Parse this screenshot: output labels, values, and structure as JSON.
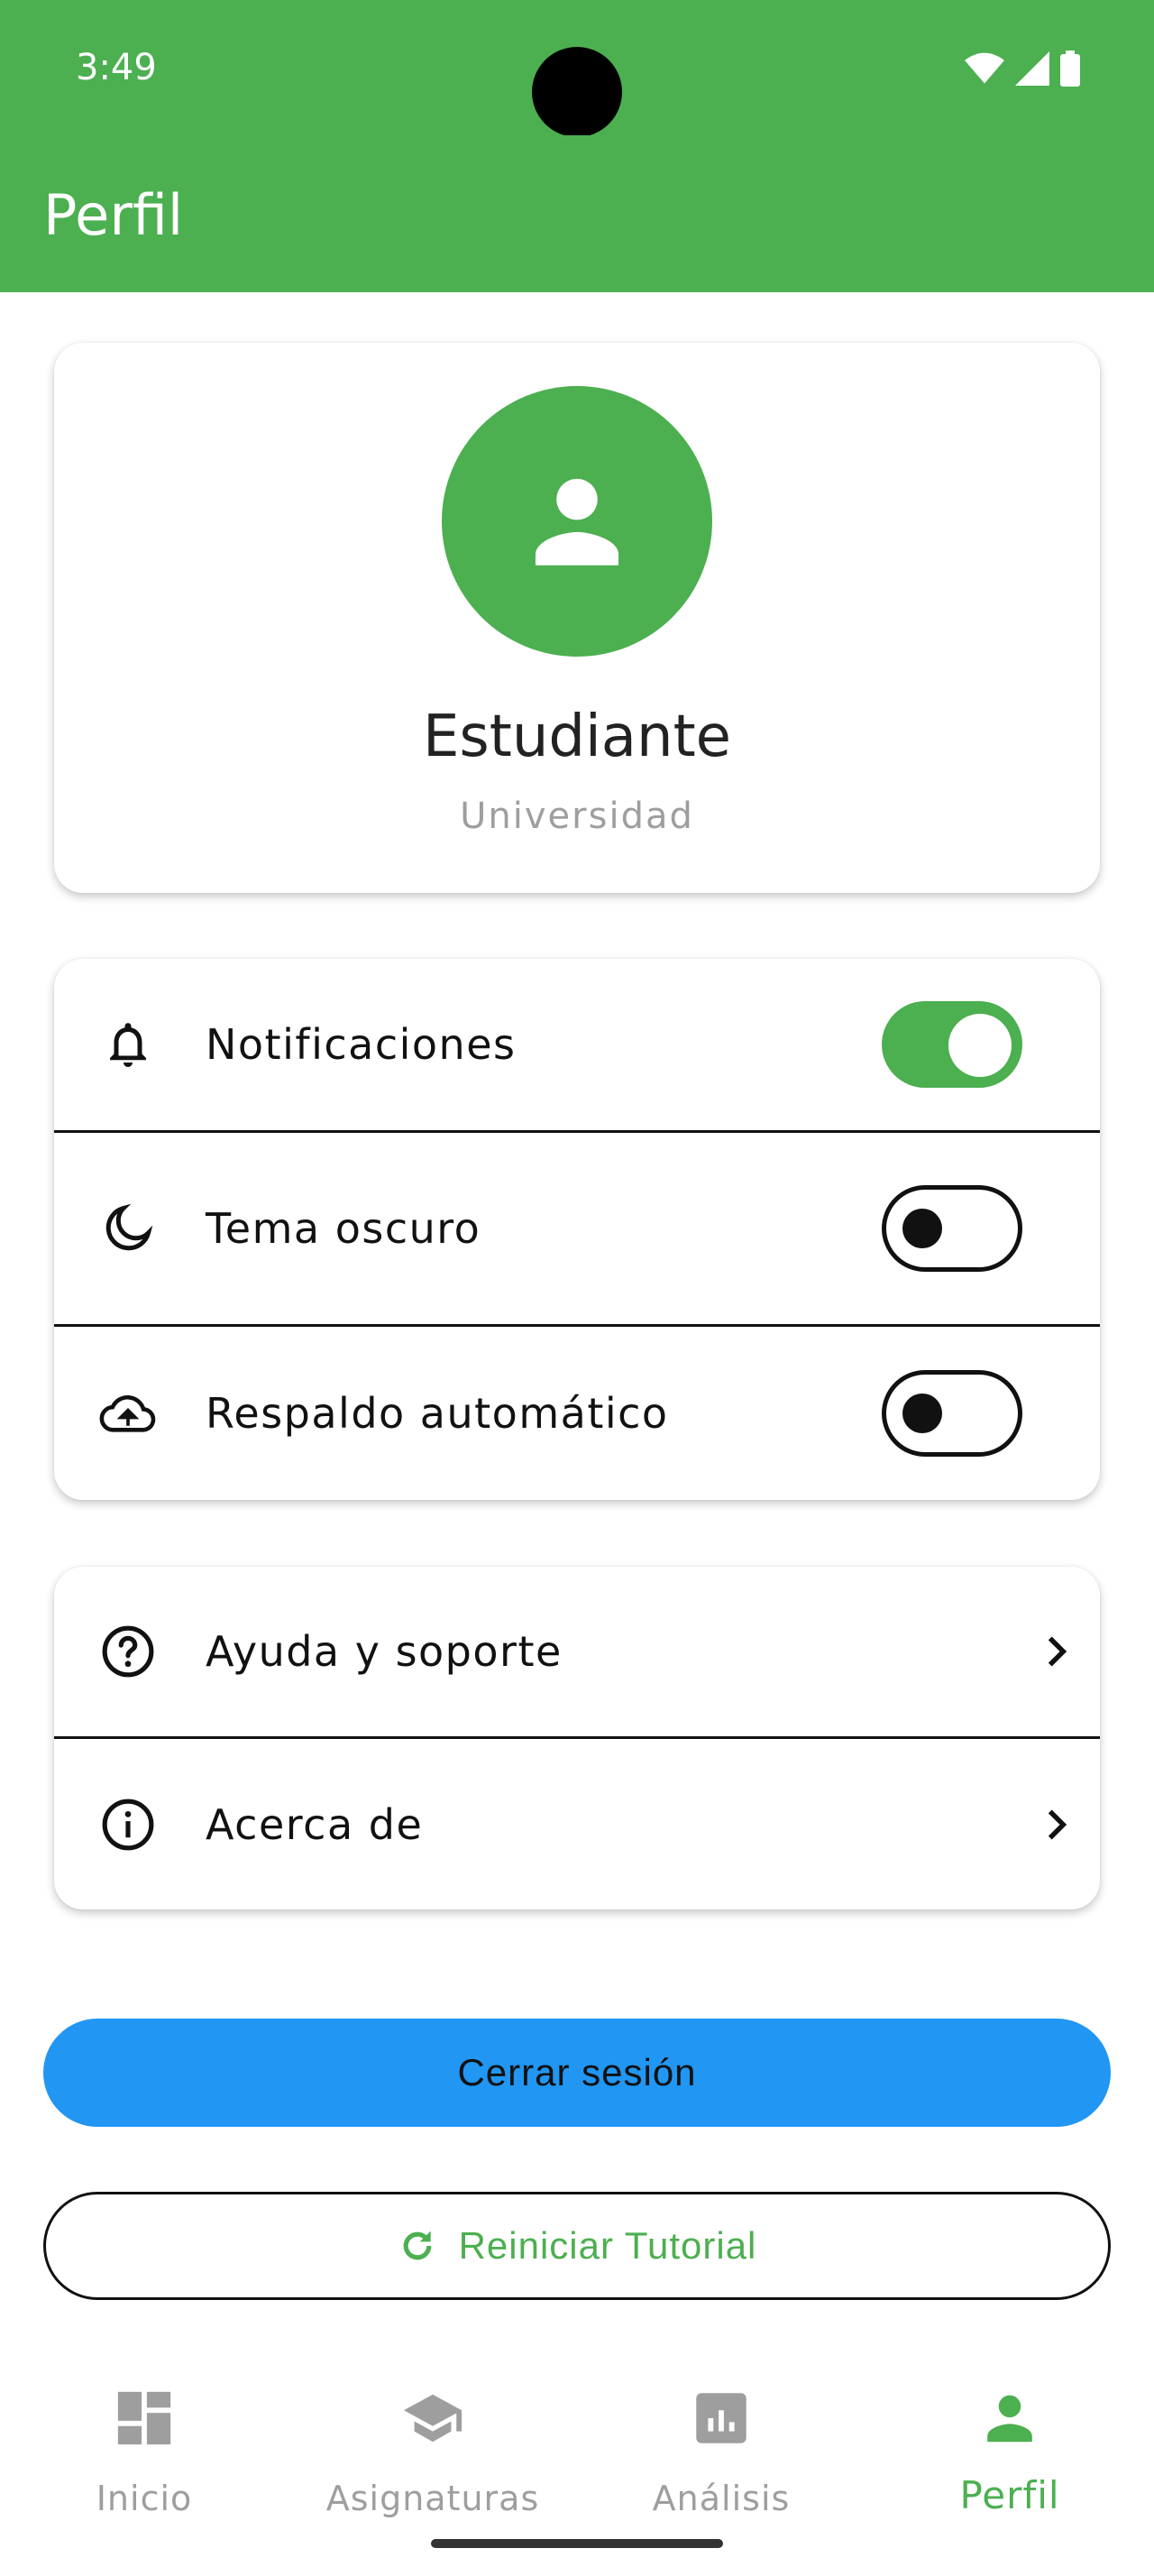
{
  "status_bar": {
    "time": "3:49"
  },
  "app_bar": {
    "title": "Perfil"
  },
  "profile": {
    "name": "Estudiante",
    "subtitle": "Universidad"
  },
  "settings": [
    {
      "label": "Notificaciones",
      "icon": "bell-icon",
      "enabled": true
    },
    {
      "label": "Tema oscuro",
      "icon": "moon-icon",
      "enabled": false
    },
    {
      "label": "Respaldo automático",
      "icon": "cloud-upload-icon",
      "enabled": false
    }
  ],
  "links": [
    {
      "label": "Ayuda y soporte",
      "icon": "help-circle-icon"
    },
    {
      "label": "Acerca de",
      "icon": "info-icon"
    }
  ],
  "buttons": {
    "logout": "Cerrar sesión",
    "reset_tutorial": "Reiniciar Tutorial"
  },
  "bottom_nav": [
    {
      "label": "Inicio",
      "icon": "dashboard-icon",
      "active": false
    },
    {
      "label": "Asignaturas",
      "icon": "school-icon",
      "active": false
    },
    {
      "label": "Análisis",
      "icon": "analytics-icon",
      "active": false
    },
    {
      "label": "Perfil",
      "icon": "person-icon",
      "active": true
    }
  ],
  "colors": {
    "primary": "#4CAF50",
    "logout_button": "#2196F3",
    "muted_text": "#9e9e9e"
  }
}
